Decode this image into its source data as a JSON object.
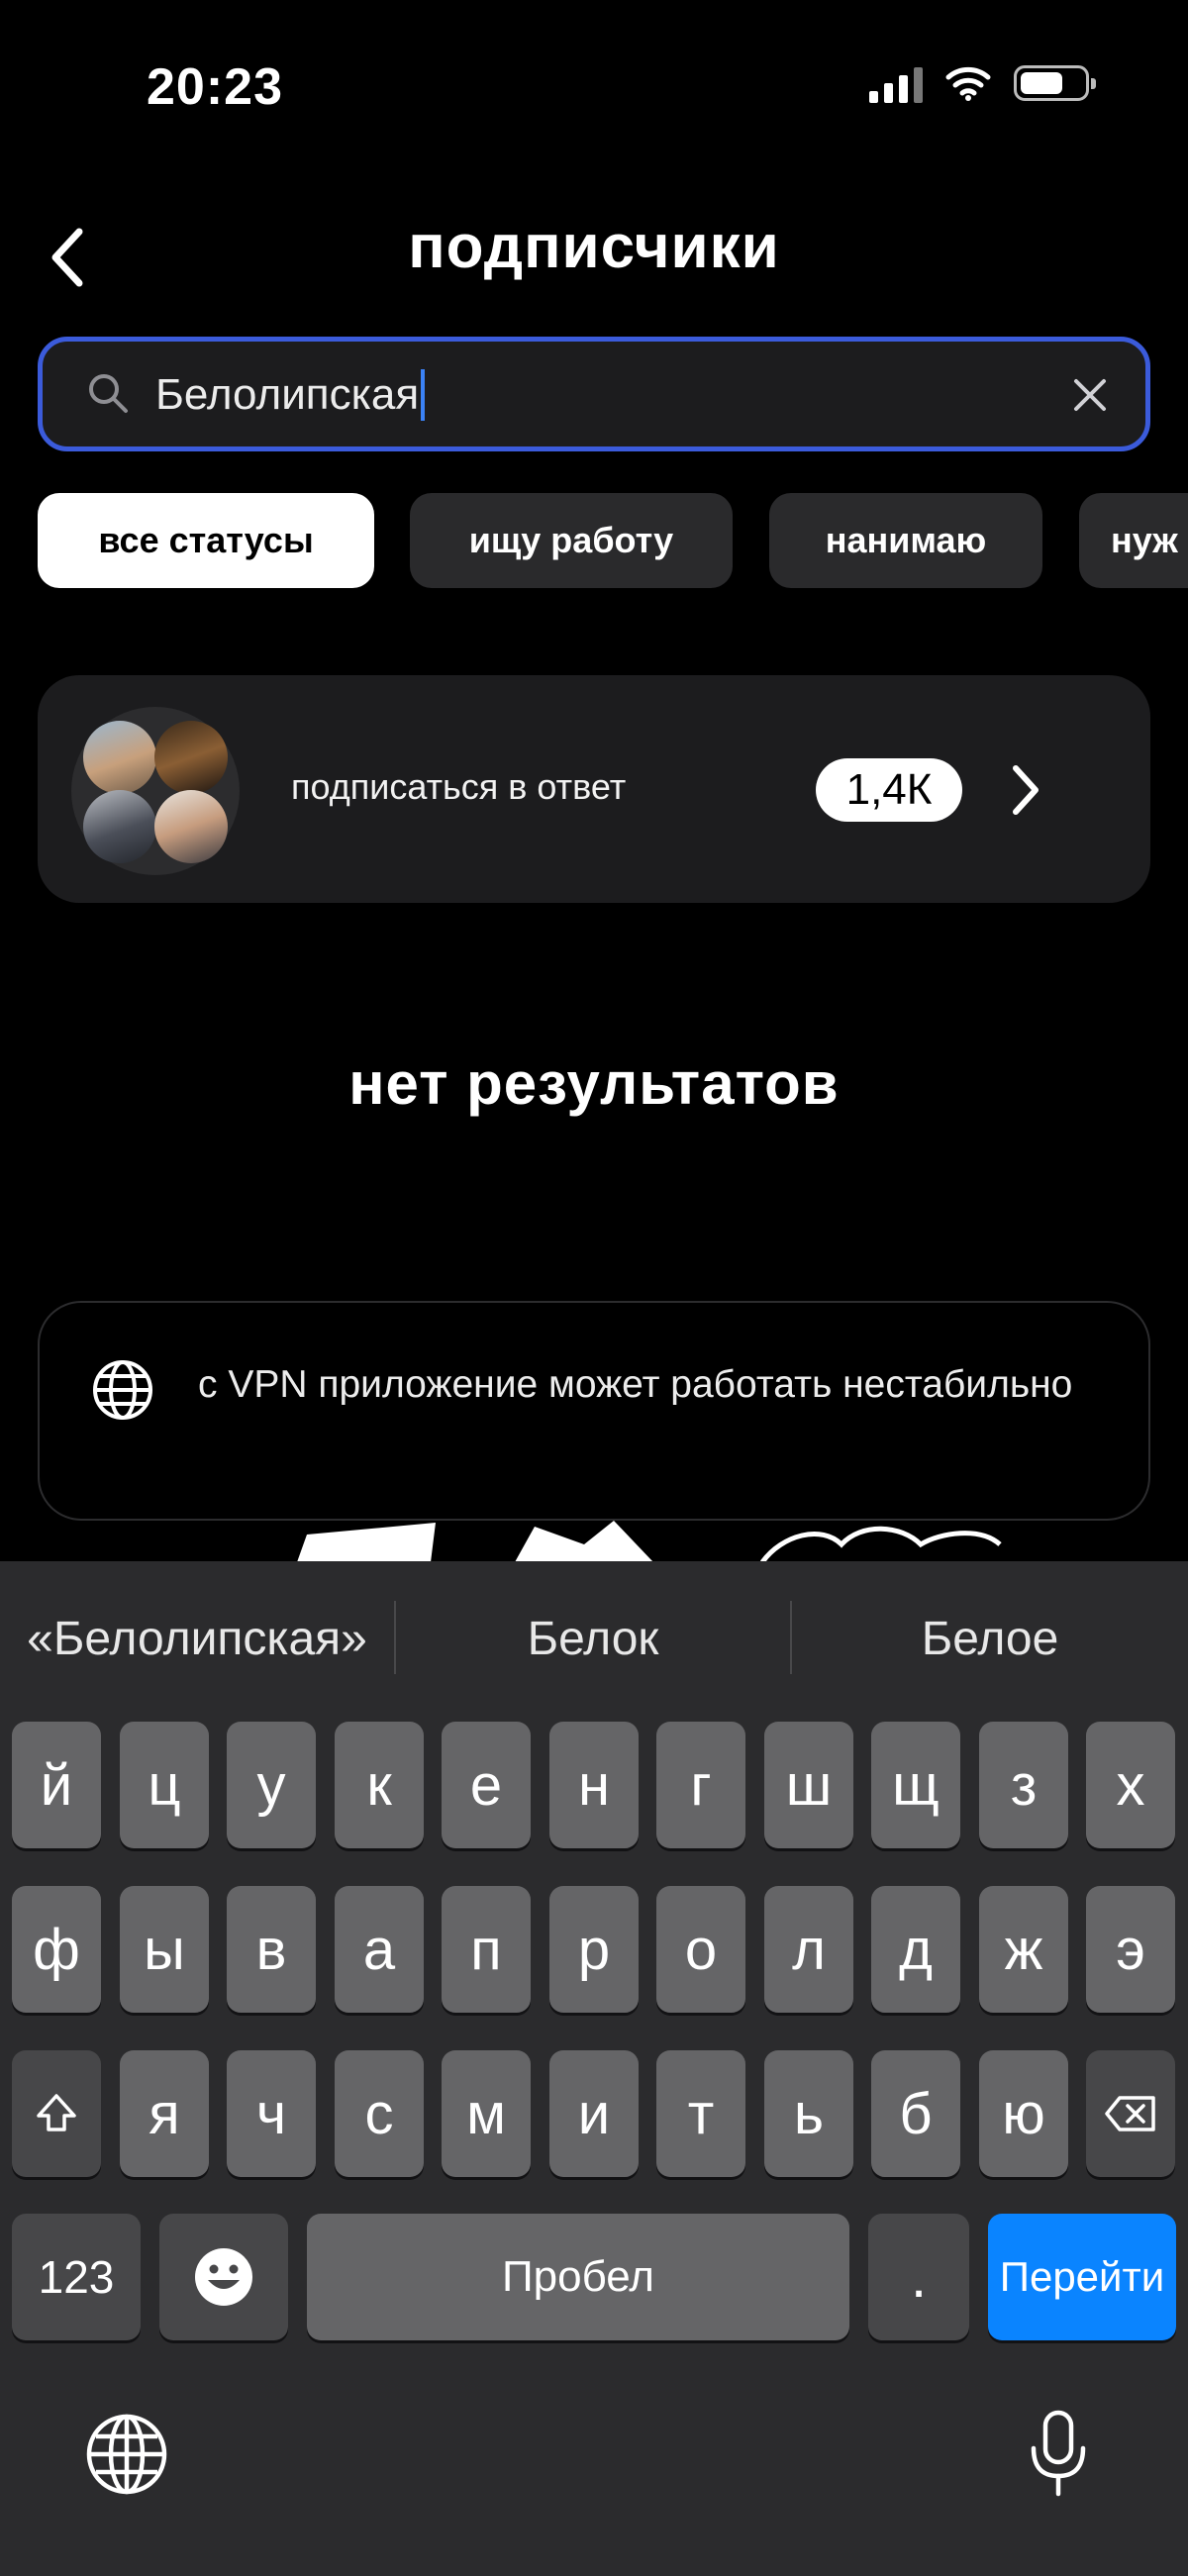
{
  "status_bar": {
    "time": "20:23"
  },
  "header": {
    "title": "подписчики"
  },
  "search": {
    "value": "Белолипская"
  },
  "filters": [
    {
      "label": "все статусы",
      "active": true
    },
    {
      "label": "ищу работу",
      "active": false
    },
    {
      "label": "нанимаю",
      "active": false
    },
    {
      "label": "нуж",
      "active": false
    }
  ],
  "follow_back": {
    "label": "подписаться в ответ",
    "count": "1,4К"
  },
  "empty_state": {
    "title": "нет результатов"
  },
  "notice": {
    "text": "с VPN приложение может работать нестабильно",
    "icon": "globe-icon"
  },
  "keyboard": {
    "suggestions": [
      "«Белолипская»",
      "Белок",
      "Белое"
    ],
    "row1": [
      "й",
      "ц",
      "у",
      "к",
      "е",
      "н",
      "г",
      "ш",
      "щ",
      "з",
      "х"
    ],
    "row2": [
      "ф",
      "ы",
      "в",
      "а",
      "п",
      "р",
      "о",
      "л",
      "д",
      "ж",
      "э"
    ],
    "row3": [
      "я",
      "ч",
      "с",
      "м",
      "и",
      "т",
      "ь",
      "б",
      "ю"
    ],
    "numbers_label": "123",
    "space_label": "Пробел",
    "period_label": ".",
    "go_label": "Перейти"
  },
  "colors": {
    "accent": "#3b5bdb",
    "go_key": "#0a84ff",
    "card": "#1c1c1e"
  }
}
